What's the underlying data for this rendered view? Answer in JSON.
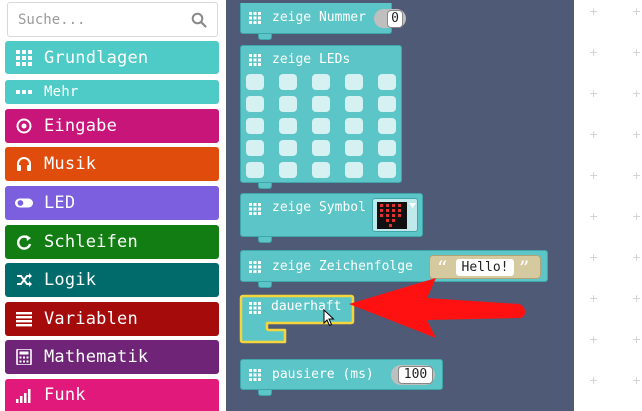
{
  "search": {
    "placeholder": "Suche..."
  },
  "toolbox": {
    "categories": [
      {
        "label": "Grundlagen",
        "color": "#4ecbc7",
        "icon": "grid-icon"
      },
      {
        "label": "Mehr",
        "color": "#4ecbc7",
        "icon": "more-dots-icon"
      },
      {
        "label": "Eingabe",
        "color": "#c8157a",
        "icon": "target-icon"
      },
      {
        "label": "Musik",
        "color": "#e04c0c",
        "icon": "headphones-icon"
      },
      {
        "label": "LED",
        "color": "#7b5fdf",
        "icon": "toggle-icon"
      },
      {
        "label": "Schleifen",
        "color": "#127d12",
        "icon": "loop-icon"
      },
      {
        "label": "Logik",
        "color": "#016b6b",
        "icon": "shuffle-icon"
      },
      {
        "label": "Variablen",
        "color": "#a50b0b",
        "icon": "list-icon"
      },
      {
        "label": "Mathematik",
        "color": "#6f2478",
        "icon": "calculator-icon"
      },
      {
        "label": "Funk",
        "color": "#e0197a",
        "icon": "signal-icon"
      }
    ]
  },
  "flyout": {
    "blocks": {
      "show_number": {
        "label": "zeige Nummer",
        "value": "0"
      },
      "show_leds": {
        "label": "zeige LEDs"
      },
      "show_icon": {
        "label": "zeige Symbol"
      },
      "show_string": {
        "label": "zeige Zeichenfolge",
        "value": "Hello!",
        "open_quote": "“",
        "close_quote": "”"
      },
      "forever": {
        "label": "dauerhaft"
      },
      "pause": {
        "label": "pausiere (ms)",
        "value": "100"
      }
    }
  },
  "colors": {
    "basic_block": "#5cc5c7",
    "flyout_bg": "#4f5b76",
    "highlight": "#f5d53b",
    "arrow": "#ff1111"
  }
}
